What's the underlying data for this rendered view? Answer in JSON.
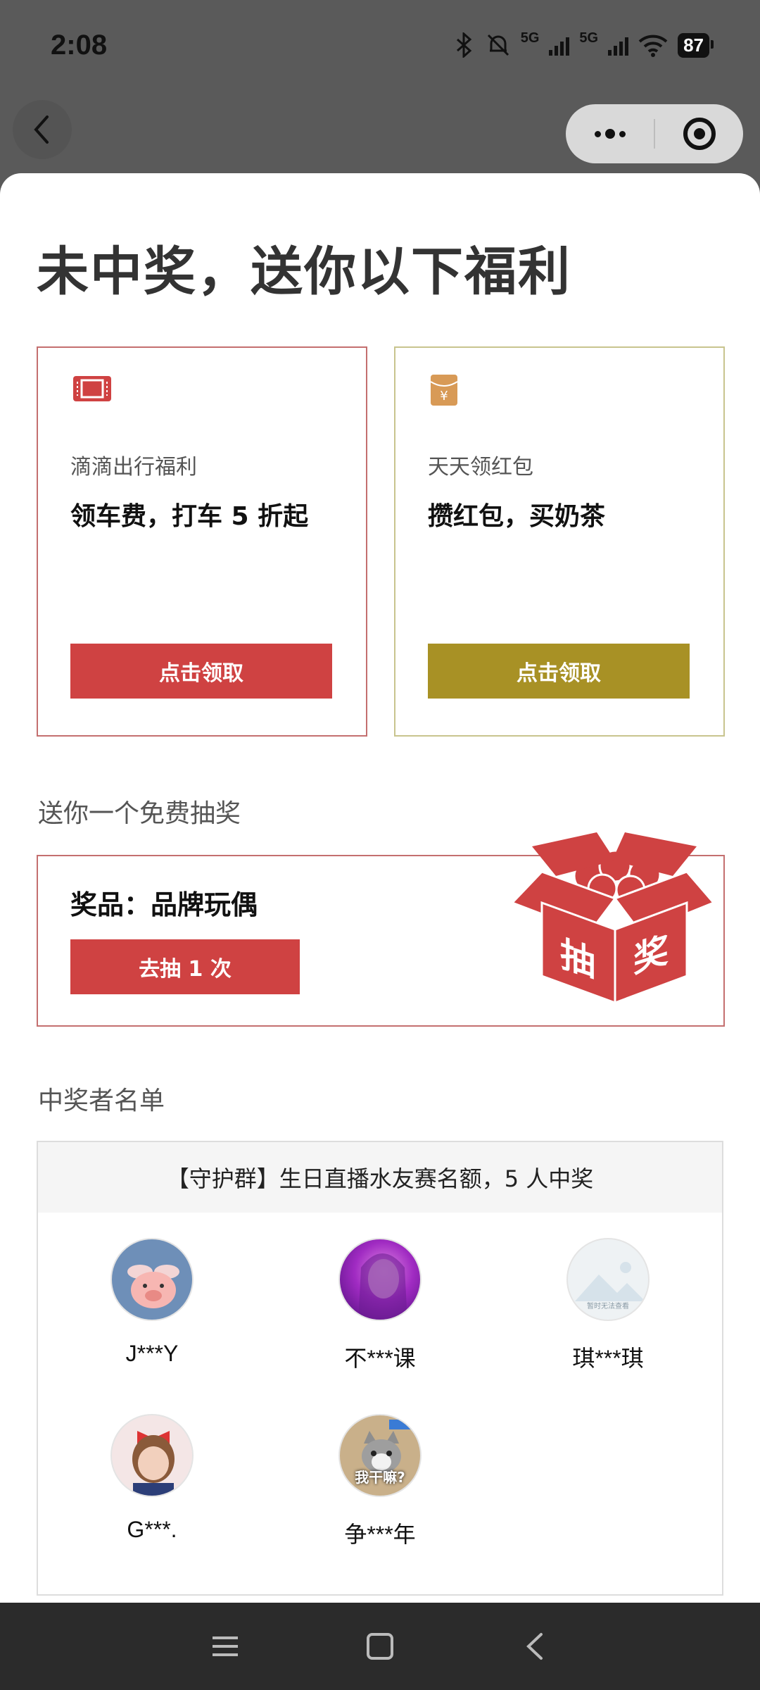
{
  "status": {
    "time": "2:08",
    "signal1": "5G",
    "signal2": "5G",
    "battery": "87"
  },
  "page": {
    "title": "未中奖，送你以下福利"
  },
  "cards": [
    {
      "sub": "滴滴出行福利",
      "main": "领车费，打车 5 折起",
      "button": "点击领取",
      "icon": "ticket-icon",
      "color": "#cf4242"
    },
    {
      "sub": "天天领红包",
      "main": "攒红包，买奶茶",
      "button": "点击领取",
      "icon": "red-envelope-icon",
      "color": "#a89125"
    }
  ],
  "lottery": {
    "section_title": "送你一个免费抽奖",
    "prize": "奖品：品牌玩偶",
    "button": "去抽 1 次",
    "box_text_1": "抽",
    "box_text_2": "奖"
  },
  "winners": {
    "section_title": "中奖者名单",
    "header": "【守护群】生日直播水友赛名额，5 人中奖",
    "list": [
      {
        "name": "J***Y",
        "avatar": "pig-avatar"
      },
      {
        "name": "不***课",
        "avatar": "purple-girl-avatar"
      },
      {
        "name": "琪***琪",
        "avatar": "placeholder-avatar",
        "placeholder_text": "暂时无法查看"
      },
      {
        "name": "G***.",
        "avatar": "child-avatar"
      },
      {
        "name": "争***年",
        "avatar": "cat-avatar",
        "caption": "我干嘛?"
      }
    ]
  },
  "colors": {
    "red": "#cf4242",
    "gold": "#a89125"
  }
}
